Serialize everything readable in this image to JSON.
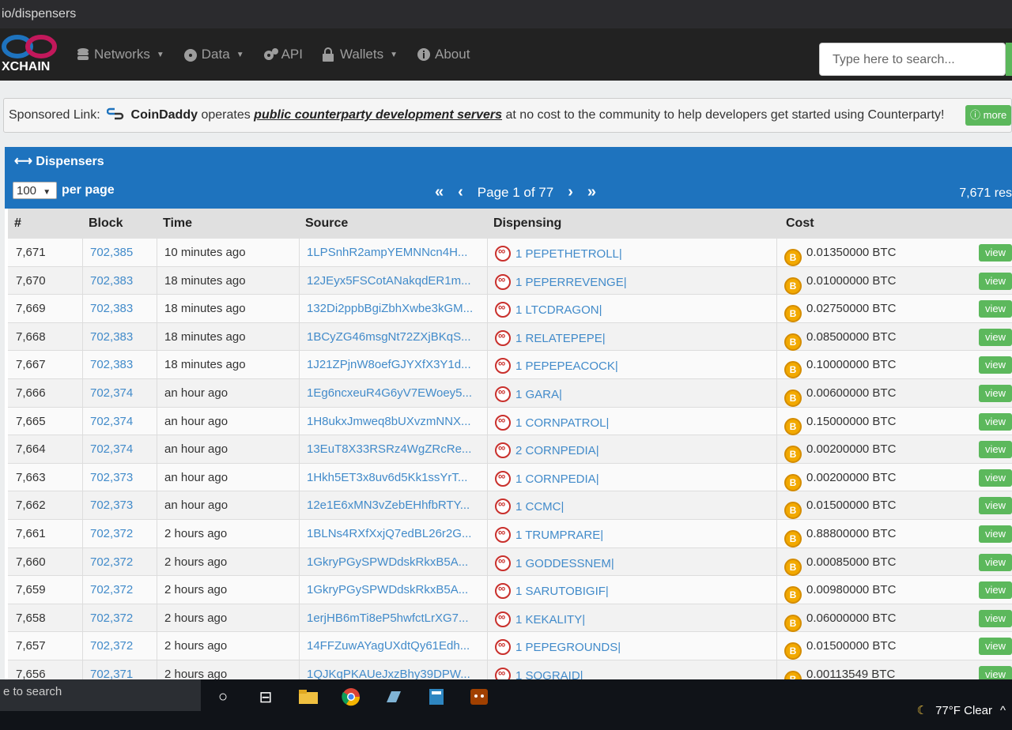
{
  "browser": {
    "url_fragment": "io/dispensers"
  },
  "nav": {
    "logo_text": "XCHAIN",
    "items": [
      {
        "label": "Networks",
        "icon": "database-icon",
        "dropdown": true
      },
      {
        "label": "Data",
        "icon": "dashboard-icon",
        "dropdown": true
      },
      {
        "label": "API",
        "icon": "gears-icon",
        "dropdown": false
      },
      {
        "label": "Wallets",
        "icon": "lock-icon",
        "dropdown": true
      },
      {
        "label": "About",
        "icon": "info-icon",
        "dropdown": false
      }
    ],
    "search_placeholder": "Type here to search..."
  },
  "sponsor": {
    "prefix": "Sponsored Link:",
    "brand": "CoinDaddy",
    "middle": "operates",
    "link": "public counterparty development servers",
    "suffix": "at no cost to the community to help developers get started using Counterparty!",
    "more_label": "more"
  },
  "panel": {
    "title": "Dispensers",
    "per_page_value": "100",
    "per_page_label": "per page",
    "page_label": "Page 1 of 77",
    "results": "7,671 res"
  },
  "table": {
    "headers": {
      "num": "#",
      "block": "Block",
      "time": "Time",
      "source": "Source",
      "dispensing": "Dispensing",
      "cost": "Cost"
    },
    "view_label": "view",
    "rows": [
      {
        "num": "7,671",
        "block": "702,385",
        "time": "10 minutes ago",
        "source": "1LPSnhR2ampYEMNNcn4H...",
        "dispensing": "1 PEPETHETROLL|",
        "cost": "0.01350000 BTC"
      },
      {
        "num": "7,670",
        "block": "702,383",
        "time": "18 minutes ago",
        "source": "12JEyx5FSCotANakqdER1m...",
        "dispensing": "1 PEPERREVENGE|",
        "cost": "0.01000000 BTC"
      },
      {
        "num": "7,669",
        "block": "702,383",
        "time": "18 minutes ago",
        "source": "132Di2ppbBgiZbhXwbe3kGM...",
        "dispensing": "1 LTCDRAGON|",
        "cost": "0.02750000 BTC"
      },
      {
        "num": "7,668",
        "block": "702,383",
        "time": "18 minutes ago",
        "source": "1BCyZG46msgNt72ZXjBKqS...",
        "dispensing": "1 RELATEPEPE|",
        "cost": "0.08500000 BTC"
      },
      {
        "num": "7,667",
        "block": "702,383",
        "time": "18 minutes ago",
        "source": "1J21ZPjnW8oefGJYXfX3Y1d...",
        "dispensing": "1 PEPEPEACOCK|",
        "cost": "0.10000000 BTC"
      },
      {
        "num": "7,666",
        "block": "702,374",
        "time": "an hour ago",
        "source": "1Eg6ncxeuR4G6yV7EWoey5...",
        "dispensing": "1 GARA|",
        "cost": "0.00600000 BTC"
      },
      {
        "num": "7,665",
        "block": "702,374",
        "time": "an hour ago",
        "source": "1H8ukxJmweq8bUXvzmNNX...",
        "dispensing": "1 CORNPATROL|",
        "cost": "0.15000000 BTC"
      },
      {
        "num": "7,664",
        "block": "702,374",
        "time": "an hour ago",
        "source": "13EuT8X33RSRz4WgZRcRe...",
        "dispensing": "2 CORNPEDIA|",
        "cost": "0.00200000 BTC"
      },
      {
        "num": "7,663",
        "block": "702,373",
        "time": "an hour ago",
        "source": "1Hkh5ET3x8uv6d5Kk1ssYrT...",
        "dispensing": "1 CORNPEDIA|",
        "cost": "0.00200000 BTC"
      },
      {
        "num": "7,662",
        "block": "702,373",
        "time": "an hour ago",
        "source": "12e1E6xMN3vZebEHhfbRTY...",
        "dispensing": "1 CCMC|",
        "cost": "0.01500000 BTC"
      },
      {
        "num": "7,661",
        "block": "702,372",
        "time": "2 hours ago",
        "source": "1BLNs4RXfXxjQ7edBL26r2G...",
        "dispensing": "1 TRUMPRARE|",
        "cost": "0.88800000 BTC"
      },
      {
        "num": "7,660",
        "block": "702,372",
        "time": "2 hours ago",
        "source": "1GkryPGySPWDdskRkxB5A...",
        "dispensing": "1 GODDESSNEM|",
        "cost": "0.00085000 BTC"
      },
      {
        "num": "7,659",
        "block": "702,372",
        "time": "2 hours ago",
        "source": "1GkryPGySPWDdskRkxB5A...",
        "dispensing": "1 SARUTOBIGIF|",
        "cost": "0.00980000 BTC"
      },
      {
        "num": "7,658",
        "block": "702,372",
        "time": "2 hours ago",
        "source": "1erjHB6mTi8eP5hwfctLrXG7...",
        "dispensing": "1 KEKALITY|",
        "cost": "0.06000000 BTC"
      },
      {
        "num": "7,657",
        "block": "702,372",
        "time": "2 hours ago",
        "source": "14FFZuwAYagUXdtQy61Edh...",
        "dispensing": "1 PEPEGROUNDS|",
        "cost": "0.01500000 BTC"
      },
      {
        "num": "7,656",
        "block": "702,371",
        "time": "2 hours ago",
        "source": "1QJKqPKAUeJxzBhy39DPW...",
        "dispensing": "1 SOGRAID|",
        "cost": "0.00113549 BTC"
      }
    ]
  },
  "taskbar": {
    "search_text": "e to search",
    "weather": "77°F  Clear"
  }
}
